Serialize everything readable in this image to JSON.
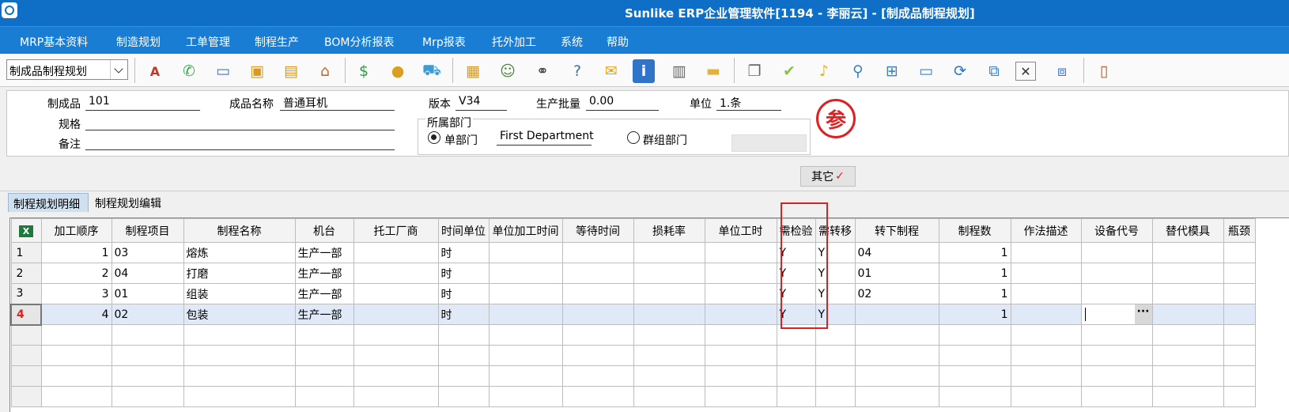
{
  "window": {
    "title": "Sunlike ERP企业管理软件[1194 - 李丽云] - [制成品制程规划]"
  },
  "menu": [
    "MRP基本资料",
    "制造规划",
    "工单管理",
    "制程生产",
    "BOM分析报表",
    "Mrp报表",
    "托外加工",
    "系统",
    "帮助"
  ],
  "toolbar": {
    "combo_value": "制成品制程规划",
    "icons": [
      "spellcheck-icon",
      "phone-icon",
      "computer-icon",
      "lock-icon",
      "briefcase-icon",
      "home-icon",
      "dollar-icon",
      "money-bag-icon",
      "cart-icon",
      "clipboard-icon",
      "users-icon",
      "link-icon",
      "help-doc-icon",
      "mail-icon",
      "info-icon",
      "calculator-icon",
      "folder-icon",
      "copy-icon",
      "ok-icon",
      "bell-icon",
      "search-icon",
      "org-chart-icon",
      "monitor-icon",
      "refresh-icon",
      "windows-icon",
      "close-icon",
      "restore-icon",
      "exit-icon"
    ]
  },
  "form": {
    "product_label": "制成品",
    "product_value": "101",
    "product_name_label": "成品名称",
    "product_name_value": "普通耳机",
    "version_label": "版本",
    "version_value": "V34",
    "batch_label": "生产批量",
    "batch_value": "0.00",
    "unit_label": "单位",
    "unit_value": "1.条",
    "spec_label": "规格",
    "spec_value": "",
    "remark_label": "备注",
    "remark_value": "",
    "dept_group_label": "所属部门",
    "single_dept_label": "单部门",
    "single_dept_value": "First Department",
    "group_dept_label": "群组部门",
    "seal_char": "参"
  },
  "other_button": {
    "label": "其它",
    "check": "✓"
  },
  "tabs": [
    "制程规划明细",
    "制程规划编辑"
  ],
  "grid": {
    "columns": [
      "加工顺序",
      "制程项目",
      "制程名称",
      "机台",
      "托工厂商",
      "时间单位",
      "单位加工时间",
      "等待时间",
      "损耗率",
      "单位工时",
      "需检验",
      "需转移",
      "转下制程",
      "制程数",
      "作法描述",
      "设备代号",
      "替代模具",
      "瓶颈"
    ],
    "rows": [
      {
        "no": "1",
        "cells": [
          "1",
          "03",
          "熔炼",
          "生产一部",
          "",
          "时",
          "",
          "",
          "",
          "",
          "Y",
          "Y",
          "04",
          "1",
          "",
          "",
          "",
          ""
        ]
      },
      {
        "no": "2",
        "cells": [
          "2",
          "04",
          "打磨",
          "生产一部",
          "",
          "时",
          "",
          "",
          "",
          "",
          "Y",
          "Y",
          "01",
          "1",
          "",
          "",
          "",
          ""
        ]
      },
      {
        "no": "3",
        "cells": [
          "3",
          "01",
          "组装",
          "生产一部",
          "",
          "时",
          "",
          "",
          "",
          "",
          "Y",
          "Y",
          "02",
          "1",
          "",
          "",
          "",
          ""
        ]
      },
      {
        "no": "4",
        "cells": [
          "4",
          "02",
          "包装",
          "生产一部",
          "",
          "时",
          "",
          "",
          "",
          "",
          "Y",
          "Y",
          "",
          "1",
          "",
          "",
          "",
          ""
        ]
      }
    ],
    "empty_rows": 4,
    "ellipsis": "···"
  }
}
